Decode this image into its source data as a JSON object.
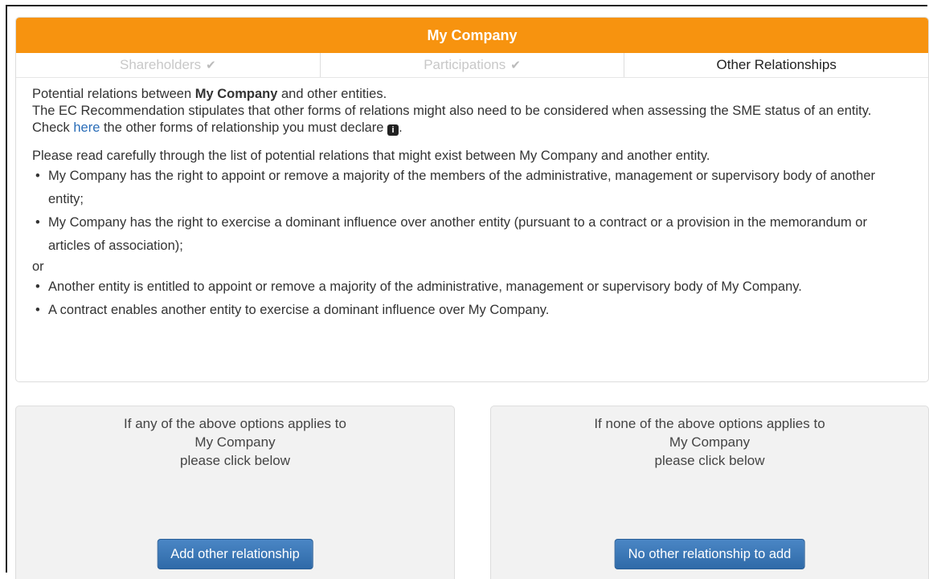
{
  "header": {
    "title": "My Company"
  },
  "tabs": [
    {
      "label": "Shareholders",
      "done": true,
      "check_icon": "checkmark-icon"
    },
    {
      "label": "Participations",
      "done": true,
      "check_icon": "checkmark-icon"
    },
    {
      "label": "Other Relationships",
      "done": false,
      "active": true
    }
  ],
  "intro": {
    "line1_pre": "Potential relations between ",
    "line1_company": "My Company",
    "line1_post": " and other entities.",
    "line2_pre": "The EC Recommendation stipulates that other forms of relations might also need to be considered when assessing the SME status of an entity. Check ",
    "link": "here",
    "line2_post": " the other forms of relationship you must declare",
    "info_icon": "info-icon",
    "end": "."
  },
  "relations": {
    "lead": "Please read carefully through the list of potential relations that might exist between My Company and another entity.",
    "group1": [
      "My Company has the right to appoint or remove a majority of the members of the administrative, management or supervisory body of another entity;",
      "My Company has the right to exercise a dominant influence over another entity (pursuant to a contract or a provision in the memorandum or articles of association);"
    ],
    "or": "or",
    "group2": [
      "Another entity is entitled to appoint or remove a majority of the administrative, management or supervisory body of My Company.",
      "A contract enables another entity to exercise a dominant influence over My Company."
    ]
  },
  "options": {
    "left": {
      "line1": "If any of the above options applies to",
      "line2": "My Company",
      "line3": "please click below",
      "button": "Add other relationship"
    },
    "right": {
      "line1": "If none of the above options applies to",
      "line2": "My Company",
      "line3": "please click below",
      "button": "No other relationship to add"
    }
  },
  "colors": {
    "header_bg": "#f7930f",
    "link": "#2a6db8",
    "button_bg": "#3a77b7"
  }
}
